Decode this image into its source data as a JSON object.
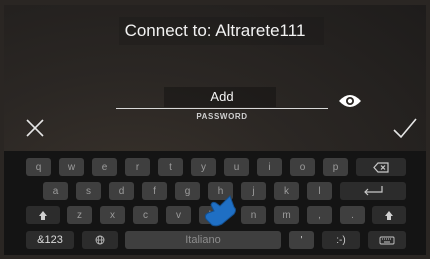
{
  "dialog": {
    "title": "Connect to: Altrarete111",
    "password_value": "Add",
    "password_label": "PASSWORD"
  },
  "icons": {
    "eye": "eye-icon",
    "cancel": "close-icon",
    "confirm": "checkmark-icon",
    "touch": "hand-pointer-icon"
  },
  "keyboard": {
    "row1": [
      "q",
      "w",
      "e",
      "r",
      "t",
      "y",
      "u",
      "i",
      "o",
      "p"
    ],
    "row2": [
      "a",
      "s",
      "d",
      "f",
      "g",
      "h",
      "j",
      "k",
      "l"
    ],
    "row3": [
      "z",
      "x",
      "c",
      "v",
      "b",
      "n",
      "m",
      ",",
      "."
    ],
    "mode_key": "&123",
    "space_label": "Italiano",
    "apostrophe": "'",
    "emoji_key": ":-)"
  },
  "colors": {
    "key_bg": "#3f3f3f",
    "keyboard_bg": "#141414",
    "accent_hand": "#1f6fc4"
  }
}
